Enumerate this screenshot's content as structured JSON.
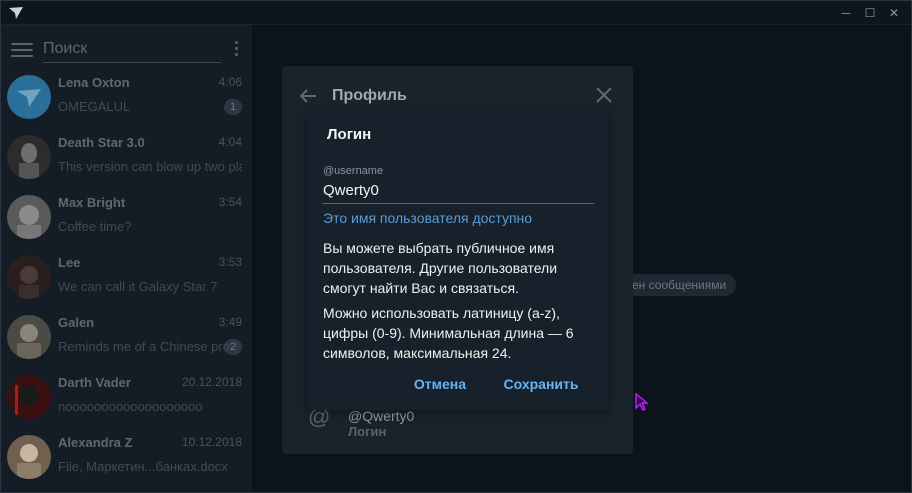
{
  "titlebar": {
    "minimize_icon": "minimize-icon",
    "maximize_icon": "maximize-icon",
    "close_icon": "close-icon",
    "minimize": "─",
    "maximize": "☐",
    "close": "✕"
  },
  "search": {
    "placeholder": "Поиск"
  },
  "chats": [
    {
      "name": "Lena Oxton",
      "time": "4:06",
      "message": "OMEGALUL",
      "badge": "1"
    },
    {
      "name": "Death Star 3.0",
      "time": "4:04",
      "message": "This version can blow up two pla",
      "badge": ""
    },
    {
      "name": "Max Bright",
      "time": "3:54",
      "message": "Coffee time?",
      "badge": ""
    },
    {
      "name": "Lee",
      "time": "3:53",
      "message": "We can call it Galaxy Star 7",
      "badge": ""
    },
    {
      "name": "Galen",
      "time": "3:49",
      "message": "Reminds me of a Chinese pro",
      "badge": "2"
    },
    {
      "name": "Darth Vader",
      "time": "20.12.2018",
      "message": "nooooooooooooooooooo",
      "badge": ""
    },
    {
      "name": "Alexandra Z",
      "time": "10.12.2018",
      "message": "File, Маркетин...банках.docx",
      "badge": ""
    }
  ],
  "main": {
    "pill_text": "ен сообщениями"
  },
  "profile": {
    "title": "Профиль",
    "username": "@Qwerty0",
    "username_label": "Логин"
  },
  "dialog": {
    "title": "Логин",
    "field_label": "@username",
    "field_value": "Qwerty0",
    "status": "Это имя пользователя доступно",
    "description_1": "Вы можете выбрать публичное имя пользователя. Другие пользователи смогут найти Вас и связаться.",
    "description_2": "Можно использовать латиницу (a-z), цифры (0-9). Минимальная длина — 6 символов, максимальная 24.",
    "cancel": "Отмена",
    "save": "Сохранить"
  },
  "colors": {
    "accent": "#64b3f4",
    "link": "#5b9bd5",
    "dialog_bg": "#17212b",
    "cursor": "#b000ff"
  }
}
